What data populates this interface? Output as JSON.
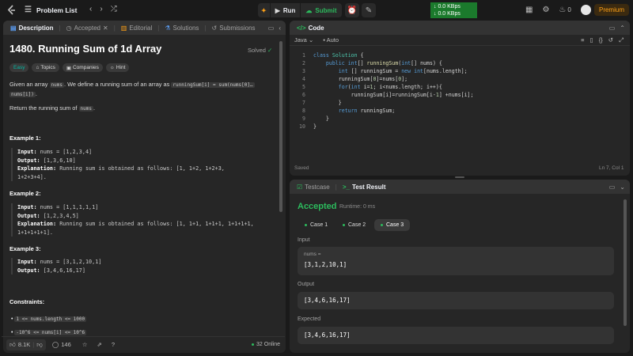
{
  "topbar": {
    "problem_list": "Problem List",
    "run": "Run",
    "submit": "Submit",
    "speed_down": "↓ 0.0 KBps",
    "speed_up": "↓ 0.0 KBps",
    "fire_count": "0",
    "premium": "Premium"
  },
  "left_tabs": [
    {
      "label": "Description"
    },
    {
      "label": "Accepted"
    },
    {
      "label": "Editorial"
    },
    {
      "label": "Solutions"
    },
    {
      "label": "Submissions"
    }
  ],
  "problem": {
    "title": "1480. Running Sum of 1d Array",
    "solved": "Solved",
    "difficulty": "Easy",
    "topics": "Topics",
    "companies": "Companies",
    "hint": "Hint",
    "desc_1": "Given an array ",
    "desc_code_1": "nums",
    "desc_2": ". We define a running sum of an array as ",
    "desc_code_2": "runningSum[i] = sum(nums[0]…",
    "desc_code_3": "nums[i])",
    "desc_3": ".",
    "desc_4": "Return the running sum of ",
    "desc_code_4": "nums",
    "desc_5": ".",
    "examples": [
      {
        "heading": "Example 1:",
        "input": "nums = [1,2,3,4]",
        "output": "[1,3,6,10]",
        "explanation": "Running sum is obtained as follows: [1, 1+2, 1+2+3,",
        "explanation2": "1+2+3+4]."
      },
      {
        "heading": "Example 2:",
        "input": "nums = [1,1,1,1,1]",
        "output": "[1,2,3,4,5]",
        "explanation": "Running sum is obtained as follows: [1, 1+1, 1+1+1, 1+1+1+1,",
        "explanation2": "1+1+1+1+1]."
      },
      {
        "heading": "Example 3:",
        "input": "nums = [3,1,2,10,1]",
        "output": "[3,4,6,16,17]"
      }
    ],
    "labels": {
      "input": "Input:",
      "output": "Output:",
      "explanation": "Explanation:"
    },
    "constraints_heading": "Constraints:",
    "constraints": [
      "1 <= nums.length <= 1000",
      "-10^6 <= nums[i] <= 10^6"
    ]
  },
  "left_footer": {
    "likes": "8.1K",
    "comments": "146",
    "online": "32 Online"
  },
  "code_panel": {
    "title": "Code",
    "language": "Java",
    "auto": "Auto",
    "saved": "Saved",
    "cursor": "Ln 7, Col 1",
    "line_numbers": [
      "1",
      "2",
      "3",
      "4",
      "5",
      "6",
      "7",
      "8",
      "9",
      "10"
    ]
  },
  "result_panel": {
    "tab_testcase": "Testcase",
    "tab_result": "Test Result",
    "status": "Accepted",
    "runtime": "Runtime: 0 ms",
    "cases": [
      "Case 1",
      "Case 2",
      "Case 3"
    ],
    "input_label": "Input",
    "input_var": "nums =",
    "input_value": "[3,1,2,10,1]",
    "output_label": "Output",
    "output_value": "[3,4,6,16,17]",
    "expected_label": "Expected",
    "expected_value": "[3,4,6,16,17]"
  }
}
